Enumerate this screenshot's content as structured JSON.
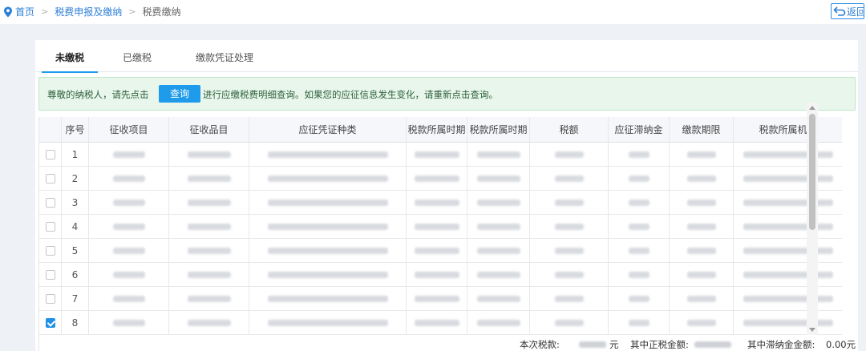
{
  "breadcrumb": {
    "home": "首页",
    "level2": "税费申报及缴纳",
    "current": "税费缴纳",
    "separator": ">"
  },
  "back_button": {
    "label": "返回",
    "icon": "return-icon"
  },
  "tabs": [
    {
      "label": "未缴税",
      "active": true
    },
    {
      "label": "已缴税",
      "active": false
    },
    {
      "label": "缴款凭证处理",
      "active": false
    }
  ],
  "notice": {
    "text_before": "尊敬的纳税人，请先点击",
    "button": "查询",
    "text_after": "进行应缴税费明细查询。如果您的应征信息发生变化，请重新点击查询。"
  },
  "table": {
    "columns": [
      "",
      "序号",
      "征收项目",
      "征收品目",
      "应征凭证种类",
      "税款所属时期",
      "税款所属时期",
      "税额",
      "应征滞纳金",
      "缴款期限",
      "税款所属机关"
    ],
    "rows": [
      {
        "no": "1",
        "checked": false
      },
      {
        "no": "2",
        "checked": false
      },
      {
        "no": "3",
        "checked": false
      },
      {
        "no": "4",
        "checked": false
      },
      {
        "no": "5",
        "checked": false
      },
      {
        "no": "6",
        "checked": false
      },
      {
        "no": "7",
        "checked": false
      },
      {
        "no": "8",
        "checked": true
      }
    ]
  },
  "footer": {
    "tax_label": "本次税款:",
    "tax_unit": "元",
    "normal_label": "其中正税金额:",
    "late_label": "其中滞纳金金额:",
    "late_value": "0.00元"
  },
  "colors": {
    "accent": "#1e9bea",
    "link": "#2d7fd6",
    "notice_bg": "#e8f6ec"
  }
}
